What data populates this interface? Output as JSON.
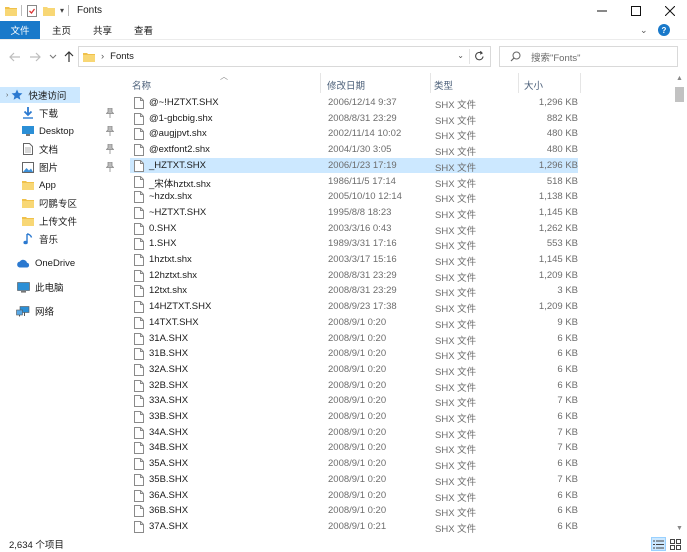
{
  "window": {
    "title": "Fonts",
    "controls": {
      "minimize": "—",
      "maximize": "☐",
      "close": "✕"
    }
  },
  "ribbon": {
    "tabs": [
      {
        "label": "文件",
        "active": true
      },
      {
        "label": "主页",
        "active": false
      },
      {
        "label": "共享",
        "active": false
      },
      {
        "label": "查看",
        "active": false
      }
    ],
    "expand_icon": "chevron-down-icon",
    "help_icon": "help-icon"
  },
  "address": {
    "breadcrumb_sep": "›",
    "path": "Fonts",
    "search_placeholder": "搜索\"Fonts\""
  },
  "sidebar": {
    "items": [
      {
        "label": "快速访问",
        "icon": "star-icon",
        "pinned": false,
        "selected": true
      },
      {
        "label": "下载",
        "icon": "download-icon",
        "pinned": true,
        "selected": false
      },
      {
        "label": "Desktop",
        "icon": "desktop-icon",
        "pinned": true,
        "selected": false
      },
      {
        "label": "文档",
        "icon": "document-icon",
        "pinned": true,
        "selected": false
      },
      {
        "label": "图片",
        "icon": "picture-icon",
        "pinned": true,
        "selected": false
      },
      {
        "label": "App",
        "icon": "folder-icon",
        "pinned": false,
        "selected": false
      },
      {
        "label": "叼鹏专区",
        "icon": "folder-icon",
        "pinned": false,
        "selected": false
      },
      {
        "label": "上传文件",
        "icon": "folder-icon",
        "pinned": false,
        "selected": false
      },
      {
        "label": "音乐",
        "icon": "music-icon",
        "pinned": false,
        "selected": false
      },
      {
        "label": "OneDrive",
        "icon": "cloud-icon",
        "pinned": false,
        "selected": false
      },
      {
        "label": "此电脑",
        "icon": "computer-icon",
        "pinned": false,
        "selected": false
      },
      {
        "label": "网络",
        "icon": "network-icon",
        "pinned": false,
        "selected": false
      }
    ]
  },
  "columns": {
    "name": "名称",
    "date": "修改日期",
    "type": "类型",
    "size": "大小"
  },
  "files": [
    {
      "name": "@~!HZTXT.SHX",
      "date": "2006/12/14 9:37",
      "type": "SHX 文件",
      "size": "1,296 KB"
    },
    {
      "name": "@1-gbcbig.shx",
      "date": "2008/8/31 23:29",
      "type": "SHX 文件",
      "size": "882 KB"
    },
    {
      "name": "@augjpvt.shx",
      "date": "2002/11/14 10:02",
      "type": "SHX 文件",
      "size": "480 KB"
    },
    {
      "name": "@extfont2.shx",
      "date": "2004/1/30 3:05",
      "type": "SHX 文件",
      "size": "480 KB"
    },
    {
      "name": "_HZTXT.SHX",
      "date": "2006/1/23 17:19",
      "type": "SHX 文件",
      "size": "1,296 KB",
      "selected": true
    },
    {
      "name": "_宋体hztxt.shx",
      "date": "1986/11/5 17:14",
      "type": "SHX 文件",
      "size": "518 KB"
    },
    {
      "name": "~hzdx.shx",
      "date": "2005/10/10 12:14",
      "type": "SHX 文件",
      "size": "1,138 KB"
    },
    {
      "name": "~HZTXT.SHX",
      "date": "1995/8/8 18:23",
      "type": "SHX 文件",
      "size": "1,145 KB"
    },
    {
      "name": "0.SHX",
      "date": "2003/3/16 0:43",
      "type": "SHX 文件",
      "size": "1,262 KB"
    },
    {
      "name": "1.SHX",
      "date": "1989/3/31 17:16",
      "type": "SHX 文件",
      "size": "553 KB"
    },
    {
      "name": "1hztxt.shx",
      "date": "2003/3/17 15:16",
      "type": "SHX 文件",
      "size": "1,145 KB"
    },
    {
      "name": "12hztxt.shx",
      "date": "2008/8/31 23:29",
      "type": "SHX 文件",
      "size": "1,209 KB"
    },
    {
      "name": "12txt.shx",
      "date": "2008/8/31 23:29",
      "type": "SHX 文件",
      "size": "3 KB"
    },
    {
      "name": "14HZTXT.SHX",
      "date": "2008/9/23 17:38",
      "type": "SHX 文件",
      "size": "1,209 KB"
    },
    {
      "name": "14TXT.SHX",
      "date": "2008/9/1 0:20",
      "type": "SHX 文件",
      "size": "9 KB"
    },
    {
      "name": "31A.SHX",
      "date": "2008/9/1 0:20",
      "type": "SHX 文件",
      "size": "6 KB"
    },
    {
      "name": "31B.SHX",
      "date": "2008/9/1 0:20",
      "type": "SHX 文件",
      "size": "6 KB"
    },
    {
      "name": "32A.SHX",
      "date": "2008/9/1 0:20",
      "type": "SHX 文件",
      "size": "6 KB"
    },
    {
      "name": "32B.SHX",
      "date": "2008/9/1 0:20",
      "type": "SHX 文件",
      "size": "6 KB"
    },
    {
      "name": "33A.SHX",
      "date": "2008/9/1 0:20",
      "type": "SHX 文件",
      "size": "7 KB"
    },
    {
      "name": "33B.SHX",
      "date": "2008/9/1 0:20",
      "type": "SHX 文件",
      "size": "6 KB"
    },
    {
      "name": "34A.SHX",
      "date": "2008/9/1 0:20",
      "type": "SHX 文件",
      "size": "7 KB"
    },
    {
      "name": "34B.SHX",
      "date": "2008/9/1 0:20",
      "type": "SHX 文件",
      "size": "7 KB"
    },
    {
      "name": "35A.SHX",
      "date": "2008/9/1 0:20",
      "type": "SHX 文件",
      "size": "6 KB"
    },
    {
      "name": "35B.SHX",
      "date": "2008/9/1 0:20",
      "type": "SHX 文件",
      "size": "7 KB"
    },
    {
      "name": "36A.SHX",
      "date": "2008/9/1 0:20",
      "type": "SHX 文件",
      "size": "6 KB"
    },
    {
      "name": "36B.SHX",
      "date": "2008/9/1 0:20",
      "type": "SHX 文件",
      "size": "6 KB"
    },
    {
      "name": "37A.SHX",
      "date": "2008/9/1 0:21",
      "type": "SHX 文件",
      "size": "6 KB"
    }
  ],
  "status": {
    "count": "2,634 个项目"
  },
  "colors": {
    "accent": "#1979ca",
    "selection": "#cce8ff",
    "folder": "#f8d775"
  }
}
